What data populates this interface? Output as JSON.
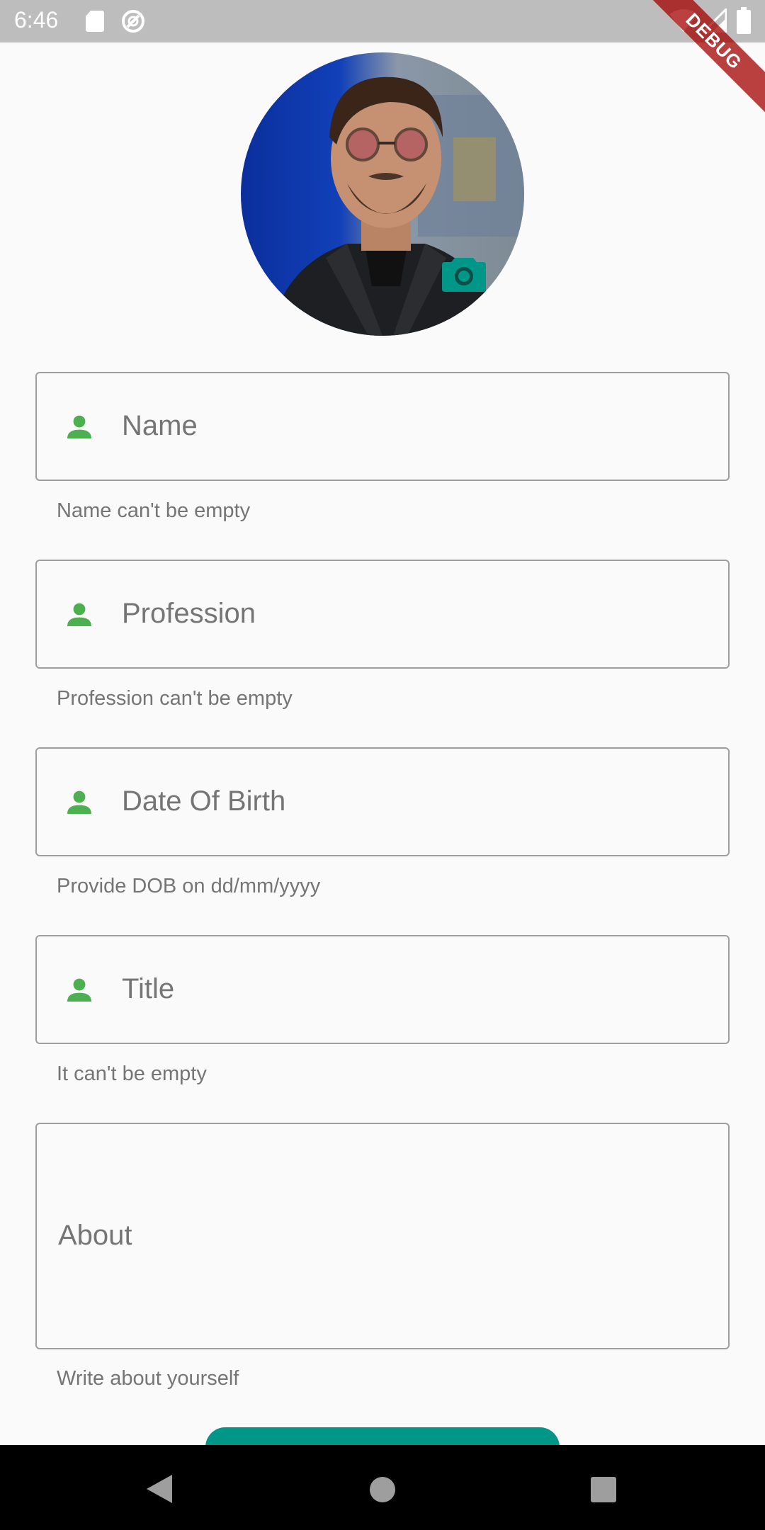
{
  "status_bar": {
    "time": "6:46"
  },
  "debug_banner": {
    "label": "DEBUG"
  },
  "profile": {
    "avatar_icon": "person-photo",
    "camera_icon": "camera-icon"
  },
  "fields": {
    "name": {
      "placeholder": "Name",
      "helper": "Name can't be empty",
      "icon": "person-icon"
    },
    "profession": {
      "placeholder": "Profession",
      "helper": "Profession can't be empty",
      "icon": "person-icon"
    },
    "dob": {
      "placeholder": "Date Of Birth",
      "helper": "Provide DOB on dd/mm/yyyy",
      "icon": "person-icon"
    },
    "title": {
      "placeholder": "Title",
      "helper": "It can't be empty",
      "icon": "person-icon"
    },
    "about": {
      "placeholder": "About",
      "helper": "Write about yourself"
    }
  },
  "colors": {
    "accent": "#009688",
    "icon_green": "#4caf50",
    "border": "#9e9e9e",
    "text_secondary": "#757575"
  },
  "nav_bar": {
    "back_icon": "back-triangle-icon",
    "home_icon": "home-circle-icon",
    "recents_icon": "recents-square-icon"
  }
}
